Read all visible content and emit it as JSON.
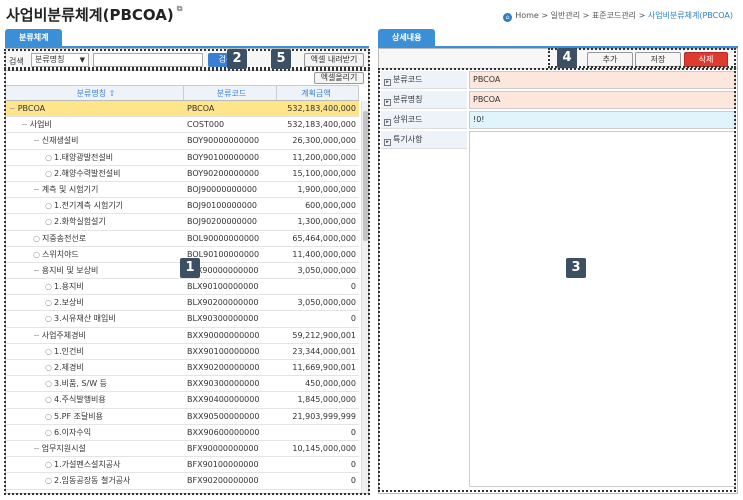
{
  "header": {
    "title": "사업비분류체계(PBCOA)",
    "title_suffix": "⧉",
    "breadcrumb": {
      "home": "Home",
      "sep": ">",
      "l1": "일반관리",
      "l2": "표준코드관리",
      "current": "사업비분류체계(PBCOA)"
    }
  },
  "left": {
    "tab": "분류체계",
    "search_label": "검색",
    "search_select": "분류명칭",
    "search_value": "",
    "search_button": "검색",
    "excel_download": "엑셀 내려받기",
    "excel_upload": "엑셀올리기",
    "columns": [
      "분류명칭 ⇧",
      "분류코드",
      "계획금액"
    ],
    "rows": [
      {
        "depth": 0,
        "name": "PBCOA",
        "code": "PBCOA",
        "amount": "532,183,400,000",
        "leaf": false
      },
      {
        "depth": 1,
        "name": "사업비",
        "code": "COST000",
        "amount": "532,183,400,000",
        "leaf": false
      },
      {
        "depth": 2,
        "name": "신재생설비",
        "code": "BOY90000000000",
        "amount": "26,300,000,000",
        "leaf": false
      },
      {
        "depth": 3,
        "name": "1.태양광발전설비",
        "code": "BOY90100000000",
        "amount": "11,200,000,000",
        "leaf": true
      },
      {
        "depth": 3,
        "name": "2.해양수력발전설비",
        "code": "BOY90200000000",
        "amount": "15,100,000,000",
        "leaf": true
      },
      {
        "depth": 2,
        "name": "계측 및 시험기기",
        "code": "BOJ90000000000",
        "amount": "1,900,000,000",
        "leaf": false
      },
      {
        "depth": 3,
        "name": "1.전기계측 시험기기",
        "code": "BOJ90100000000",
        "amount": "600,000,000",
        "leaf": true
      },
      {
        "depth": 3,
        "name": "2.화학실험설기",
        "code": "BOJ90200000000",
        "amount": "1,300,000,000",
        "leaf": true
      },
      {
        "depth": 2,
        "name": "지중송전선로",
        "code": "BOL90000000000",
        "amount": "65,464,000,000",
        "leaf": true
      },
      {
        "depth": 2,
        "name": "스위치야드",
        "code": "BOL90100000000",
        "amount": "11,400,000,000",
        "leaf": true
      },
      {
        "depth": 2,
        "name": "용지비 및 보상비",
        "code": "BLX90000000000",
        "amount": "3,050,000,000",
        "leaf": false
      },
      {
        "depth": 3,
        "name": "1.용지비",
        "code": "BLX90100000000",
        "amount": "0",
        "leaf": true
      },
      {
        "depth": 3,
        "name": "2.보상비",
        "code": "BLX90200000000",
        "amount": "3,050,000,000",
        "leaf": true
      },
      {
        "depth": 3,
        "name": "3.시유재산 매입비",
        "code": "BLX90300000000",
        "amount": "0",
        "leaf": true
      },
      {
        "depth": 2,
        "name": "사업주체경비",
        "code": "BXX90000000000",
        "amount": "59,212,900,001",
        "leaf": false
      },
      {
        "depth": 3,
        "name": "1.인건비",
        "code": "BXX90100000000",
        "amount": "23,344,000,001",
        "leaf": true
      },
      {
        "depth": 3,
        "name": "2.제경비",
        "code": "BXX90200000000",
        "amount": "11,669,900,001",
        "leaf": true
      },
      {
        "depth": 3,
        "name": "3.비품, S/W 등",
        "code": "BXX90300000000",
        "amount": "450,000,000",
        "leaf": true
      },
      {
        "depth": 3,
        "name": "4.주식발행비용",
        "code": "BXX90400000000",
        "amount": "1,845,000,000",
        "leaf": true
      },
      {
        "depth": 3,
        "name": "5.PF 조달비용",
        "code": "BXX90500000000",
        "amount": "21,903,999,999",
        "leaf": true
      },
      {
        "depth": 3,
        "name": "6.이자수익",
        "code": "BXX90600000000",
        "amount": "0",
        "leaf": true
      },
      {
        "depth": 2,
        "name": "업무지원시설",
        "code": "BFX90000000000",
        "amount": "10,145,000,000",
        "leaf": false
      },
      {
        "depth": 3,
        "name": "1.가설펜스설치공사",
        "code": "BFX90100000000",
        "amount": "0",
        "leaf": true
      },
      {
        "depth": 3,
        "name": "2.임동공장동 철거공사",
        "code": "BFX90200000000",
        "amount": "0",
        "leaf": true
      }
    ]
  },
  "right": {
    "tab": "상세내용",
    "add": "추가",
    "save": "저장",
    "delete": "삭제",
    "fields": [
      {
        "label": "분류코드",
        "value": "PBCOA",
        "tone": "peach"
      },
      {
        "label": "분류명칭",
        "value": "PBCOA",
        "tone": "peach"
      },
      {
        "label": "상위코드",
        "value": "!0!",
        "tone": "cyan"
      }
    ],
    "memo_label": "특기사항",
    "memo_value": ""
  },
  "badges": [
    "1",
    "2",
    "3",
    "4",
    "5"
  ],
  "colors": {
    "accent": "#3b8fd6",
    "selected_row": "#ffe58a",
    "delete": "#dd3b30",
    "badge": "#3d4f63"
  }
}
